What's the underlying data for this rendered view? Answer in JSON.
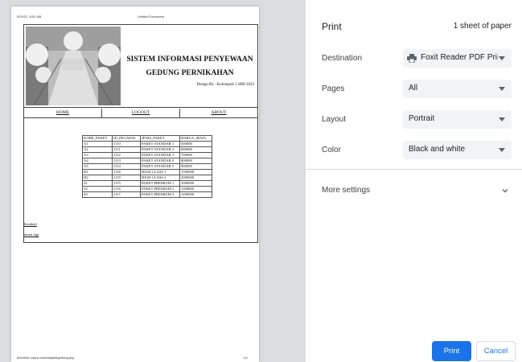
{
  "preview": {
    "header_date": "5/20/22, 8:51 AM",
    "header_title": "Untitled Document",
    "footer_url": "dhenihen.epizy.com/tampiletgedung.php",
    "footer_page": "1/1",
    "site_title_line1": "SISTEM INFORMASI PENYEWAAN",
    "site_title_line2": "GEDUNG PERNIKAHAN",
    "design_by": "Design By : Kelompok 5 SIM 2022",
    "nav": [
      "HOME",
      "LOGOUT",
      "ABOUT"
    ],
    "table": {
      "headers": [
        "KODE_PAKET",
        "ID_PEGAWAI",
        "JENIS_PAKET",
        "HARGA_SEWA"
      ],
      "rows": [
        [
          "A1",
          "1110",
          "PAKET STANDAR 1",
          "500000"
        ],
        [
          "A2",
          "1111",
          "PAKET STANDAR 2",
          "600000"
        ],
        [
          "A3",
          "1112",
          "PAKET STANDAR 3",
          "700000"
        ],
        [
          "A4",
          "1113",
          "PAKET STANDAR 4",
          "800000"
        ],
        [
          "A5",
          "1114",
          "PAKET STANDAR 5",
          "900000"
        ],
        [
          "H1",
          "1118",
          "HIGH CLASS 1",
          "1500000"
        ],
        [
          "H2",
          "1119",
          "HIGH CLASS 2",
          "2000000"
        ],
        [
          "S1",
          "1115",
          "PAKET PREMIUM 1",
          "1000000"
        ],
        [
          "S2",
          "1116",
          "PAKET PREMIUM 2",
          "1100000"
        ],
        [
          "S3",
          "1117",
          "PAKET PREMIUM 3",
          "1200000"
        ]
      ]
    },
    "link_1": "Kembali",
    "link_2": "tamat lagi"
  },
  "panel": {
    "title": "Print",
    "sheets": "1 sheet of paper",
    "destination_label": "Destination",
    "destination_value": "Foxit Reader PDF Printe",
    "destination_icon": "printer-icon",
    "pages_label": "Pages",
    "pages_value": "All",
    "layout_label": "Layout",
    "layout_value": "Portrait",
    "color_label": "Color",
    "color_value": "Black and white",
    "more_settings": "More settings",
    "print_button": "Print",
    "cancel_button": "Cancel"
  },
  "colors": {
    "accent": "#1a73e8",
    "preview_background": "#dadce0",
    "select_background": "#f1f3f4"
  }
}
